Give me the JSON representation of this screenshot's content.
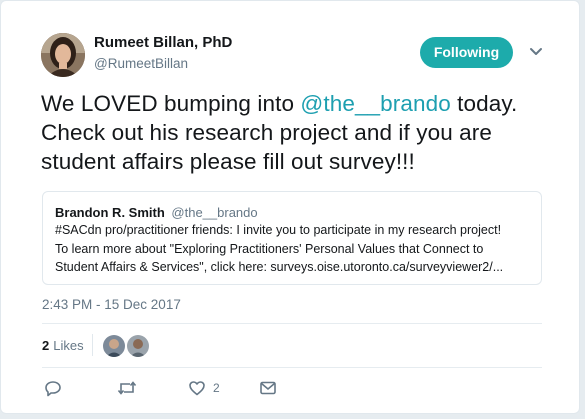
{
  "author": {
    "name": "Rumeet Billan, PhD",
    "handle": "@RumeetBillan",
    "avatar_icon": "user-avatar-icon"
  },
  "follow_button": {
    "label": "Following",
    "color": "#1dabab"
  },
  "tweet": {
    "text_before": "We LOVED bumping into ",
    "mention": "@the__brando",
    "text_after": " today. Check out his research project and if you are student affairs please fill out survey!!!"
  },
  "quoted_tweet": {
    "name": "Brandon R. Smith",
    "handle": "@the__brando",
    "lines": [
      "#SACdn pro/practitioner friends: I invite you to participate in my research project!",
      "To learn more about \"Exploring Practitioners' Personal Values that Connect to",
      "Student Affairs & Services\", click here: surveys.oise.utoronto.ca/surveyviewer2/..."
    ]
  },
  "timestamp": "2:43 PM - 15 Dec 2017",
  "stats": {
    "likes_count": "2",
    "likes_label": "Likes"
  },
  "actions": {
    "reply_icon": "reply-icon",
    "retweet_icon": "retweet-icon",
    "like_icon": "heart-icon",
    "like_count": "2",
    "message_icon": "envelope-icon"
  },
  "colors": {
    "accent": "#1dabab",
    "mention": "#1d9fb0",
    "muted": "#657786",
    "border": "#e1e8ed",
    "page_bg": "#e6ecf0"
  }
}
